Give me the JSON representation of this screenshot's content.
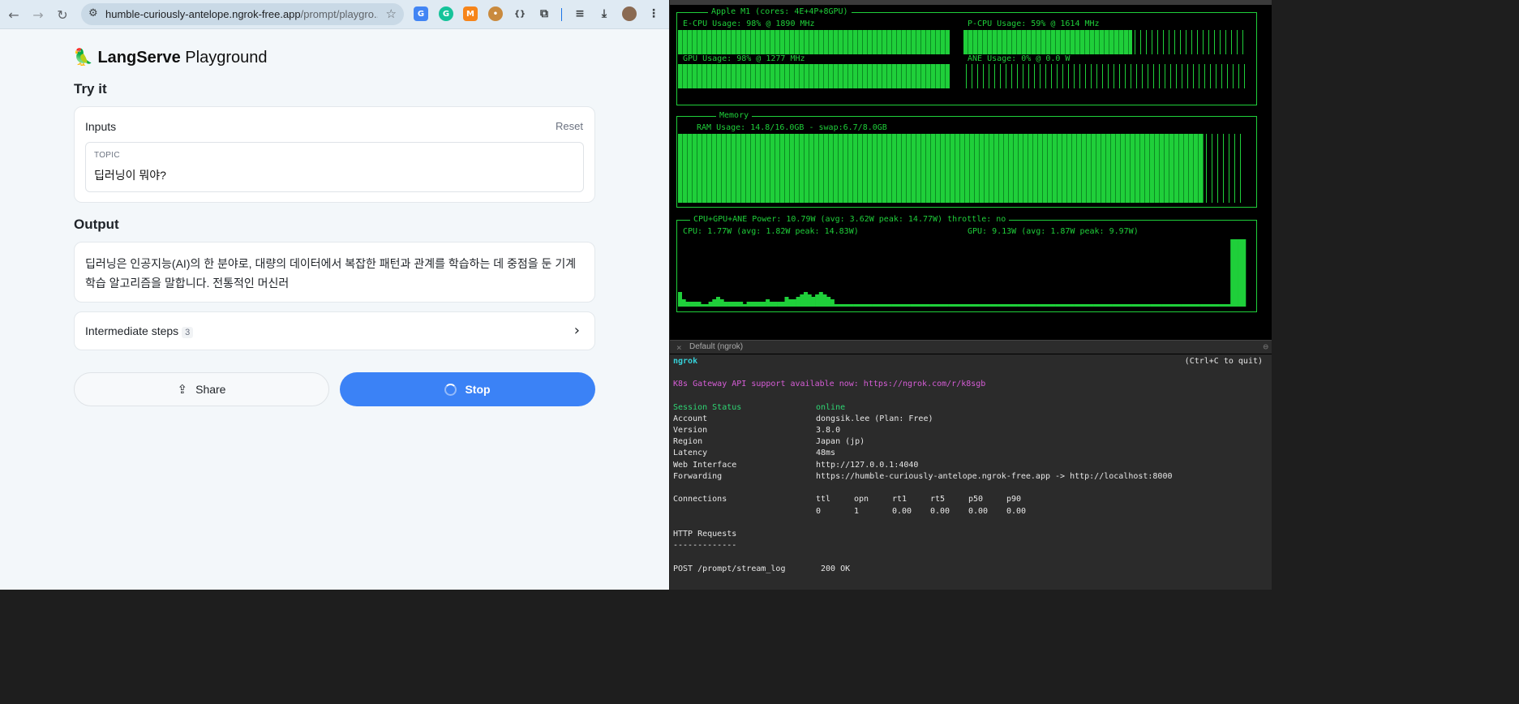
{
  "browser": {
    "url": {
      "host": "humble-curiously-antelope.ngrok-free.app",
      "path": "/prompt/playgro..."
    },
    "extensions": [
      "translate-icon",
      "grammarly-icon",
      "metamask-icon",
      "cookie-icon",
      "json-icon",
      "puzzle-icon"
    ]
  },
  "app": {
    "brand_bold": "LangServe",
    "brand_light": "Playground",
    "try_it": "Try it",
    "inputs_label": "Inputs",
    "reset_label": "Reset",
    "topic_label": "TOPIC",
    "topic_value": "딥러닝이 뭐야?",
    "output_heading": "Output",
    "output_text": "딥러닝은 인공지능(AI)의 한 분야로, 대량의 데이터에서 복잡한 패턴과 관계를 학습하는 데 중점을 둔 기계 학습 알고리즘을 말합니다. 전통적인 머신러",
    "steps_label": "Intermediate steps",
    "steps_count": "3",
    "share_label": "Share",
    "stop_label": "Stop"
  },
  "monitor": {
    "chip_title": "Apple M1 (cores: 4E+4P+8GPU)",
    "ecpu": "E-CPU Usage: 98% @ 1890 MHz",
    "pcpu": "P-CPU Usage: 59% @ 1614 MHz",
    "gpu": "GPU Usage: 98% @ 1277 MHz",
    "ane": "ANE Usage: 0% @ 0.0 W",
    "memory_title": "Memory",
    "ram": "RAM Usage: 14.8/16.0GB - swap:6.7/8.0GB",
    "power_title": "CPU+GPU+ANE Power: 10.79W (avg: 3.62W peak: 14.77W) throttle: no",
    "cpu_power": "CPU: 1.77W (avg: 1.82W peak: 14.83W)",
    "gpu_power": "GPU: 9.13W (avg: 1.87W peak: 9.97W)",
    "levels": {
      "ecpu": 0.98,
      "pcpu": 0.59,
      "gpu": 0.98,
      "ane": 0.0,
      "ram": 0.925
    }
  },
  "ngrok": {
    "pane_name": "Default (ngrok)",
    "title": "ngrok",
    "quit_hint": "(Ctrl+C to quit)",
    "notice": "K8s Gateway API support available now: https://ngrok.com/r/k8sgb",
    "rows": [
      {
        "key": "Session Status",
        "value": "online"
      },
      {
        "key": "Account",
        "value": "dongsik.lee (Plan: Free)"
      },
      {
        "key": "Version",
        "value": "3.8.0"
      },
      {
        "key": "Region",
        "value": "Japan (jp)"
      },
      {
        "key": "Latency",
        "value": "48ms"
      },
      {
        "key": "Web Interface",
        "value": "http://127.0.0.1:4040"
      },
      {
        "key": "Forwarding",
        "value": "https://humble-curiously-antelope.ngrok-free.app -> http://localhost:8000"
      }
    ],
    "connections_label": "Connections",
    "conn_headers": [
      "ttl",
      "opn",
      "rt1",
      "rt5",
      "p50",
      "p90"
    ],
    "conn_values": [
      "0",
      "1",
      "0.00",
      "0.00",
      "0.00",
      "0.00"
    ],
    "http_label": "HTTP Requests",
    "http_rule": "-------------",
    "request": {
      "line": "POST /prompt/stream_log",
      "status": "200 OK"
    }
  },
  "colors": {
    "accent": "#3b82f6",
    "terminal_green": "#1fcf3a",
    "ngrok_cyan": "#36d1d9"
  }
}
